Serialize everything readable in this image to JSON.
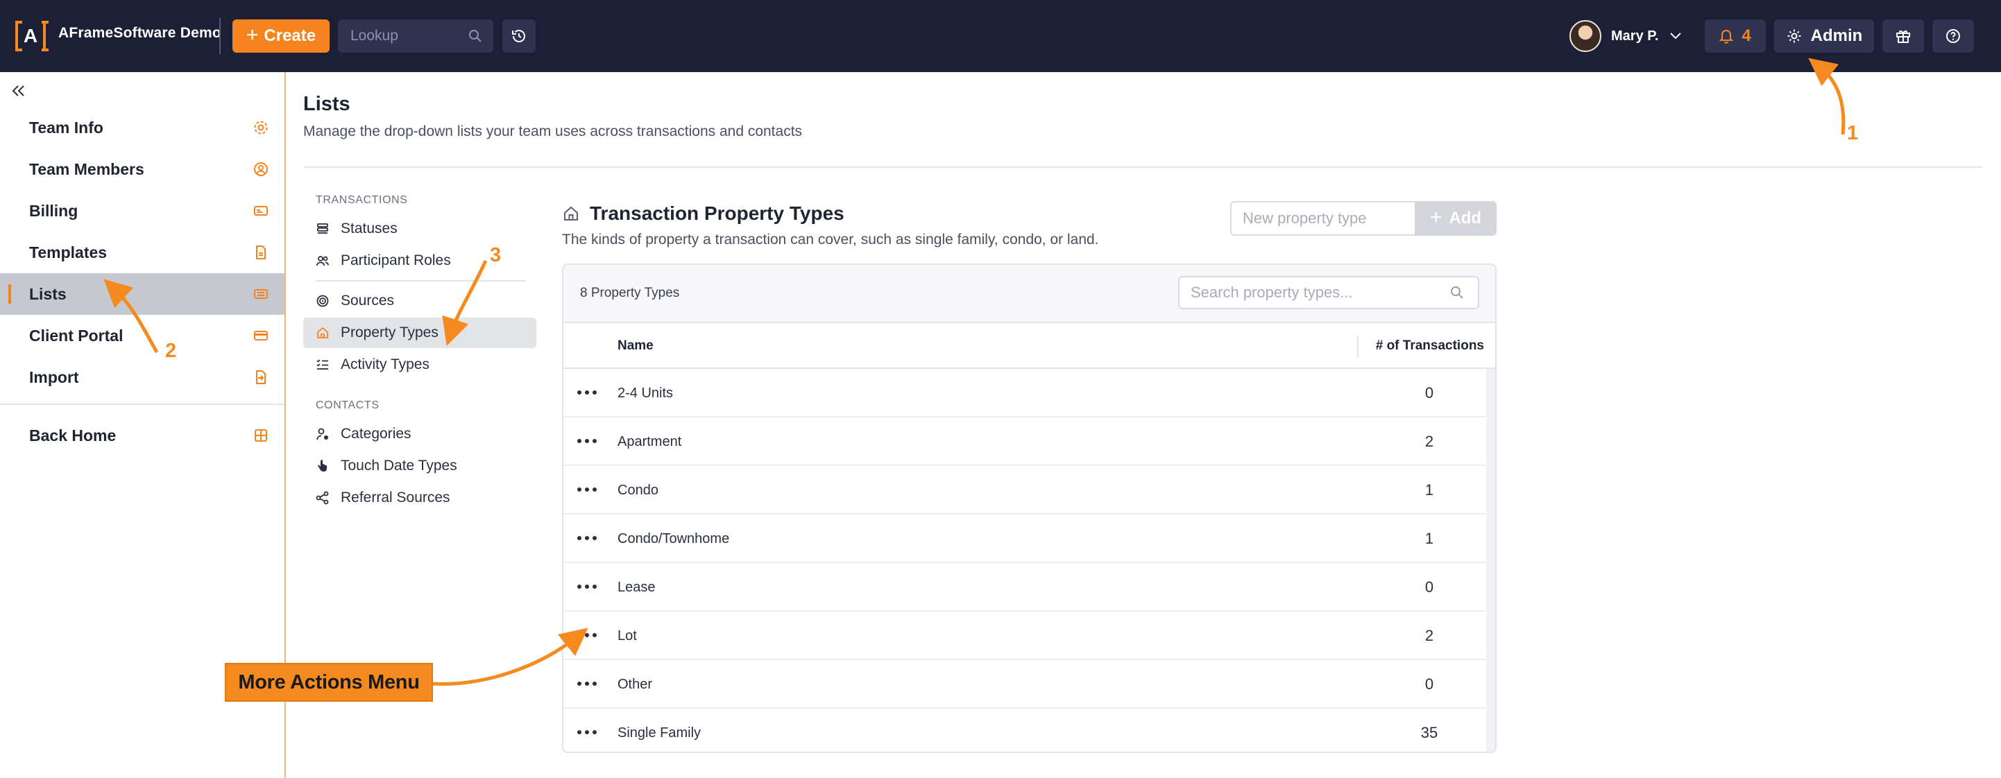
{
  "topbar": {
    "logo_letter": "A",
    "brand": "AFrameSoftware Demo",
    "create_label": "Create",
    "lookup_placeholder": "Lookup",
    "user_name": "Mary P.",
    "notification_count": "4",
    "admin_label": "Admin"
  },
  "sidebar": {
    "items": [
      {
        "label": "Team Info",
        "icon": "gear-icon"
      },
      {
        "label": "Team Members",
        "icon": "user-circle-icon"
      },
      {
        "label": "Billing",
        "icon": "billing-card-icon"
      },
      {
        "label": "Templates",
        "icon": "document-icon"
      },
      {
        "label": "Lists",
        "icon": "list-icon"
      },
      {
        "label": "Client Portal",
        "icon": "portal-icon"
      },
      {
        "label": "Import",
        "icon": "import-icon"
      }
    ],
    "back_home": "Back Home",
    "active_item": "Lists"
  },
  "page": {
    "title": "Lists",
    "subtitle": "Manage the drop-down lists your team uses across transactions and contacts"
  },
  "subnav": {
    "transactions_header": "TRANSACTIONS",
    "transactions": [
      "Statuses",
      "Participant Roles",
      "Sources",
      "Property Types",
      "Activity Types"
    ],
    "contacts_header": "CONTACTS",
    "contacts": [
      "Categories",
      "Touch Date Types",
      "Referral Sources"
    ],
    "active_item": "Property Types"
  },
  "content": {
    "title": "Transaction Property Types",
    "subtitle": "The kinds of property a transaction can cover, such as single family, condo, or land.",
    "new_placeholder": "New property type",
    "add_label": "Add",
    "count_label": "8 Property Types",
    "search_placeholder": "Search property types...",
    "columns": {
      "name": "Name",
      "count": "# of Transactions"
    },
    "rows": [
      {
        "name": "2-4 Units",
        "count": "0"
      },
      {
        "name": "Apartment",
        "count": "2"
      },
      {
        "name": "Condo",
        "count": "1"
      },
      {
        "name": "Condo/Townhome",
        "count": "1"
      },
      {
        "name": "Lease",
        "count": "0"
      },
      {
        "name": "Lot",
        "count": "2"
      },
      {
        "name": "Other",
        "count": "0"
      },
      {
        "name": "Single Family",
        "count": "35"
      }
    ]
  },
  "annotations": {
    "callout": "More Actions Menu",
    "num1": "1",
    "num2": "2",
    "num3": "3"
  },
  "colors": {
    "topbar_bg": "#1c1f35",
    "accent": "#f5841f",
    "active_sidebar_bg": "#c5c8ce"
  }
}
